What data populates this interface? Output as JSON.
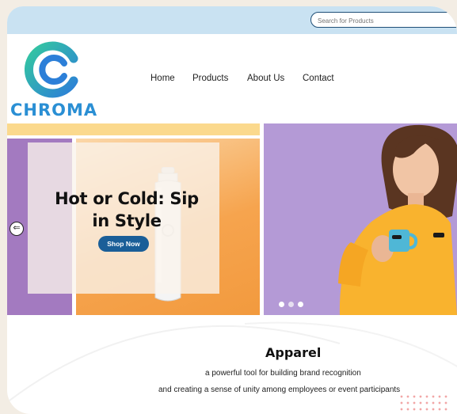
{
  "header": {
    "search_placeholder": "Search for Products"
  },
  "brand": {
    "name": "CHROMA",
    "logo_colors": [
      "#2fc3a9",
      "#2c7fd8"
    ]
  },
  "nav": {
    "items": [
      {
        "label": "Home"
      },
      {
        "label": "Products"
      },
      {
        "label": "About Us"
      },
      {
        "label": "Contact"
      }
    ]
  },
  "hero": {
    "headline_line1": "Hot or Cold: Sip",
    "headline_line2": "in Style",
    "cta_label": "Shop Now",
    "prev_arrow_glyph": "⇐",
    "carousel": {
      "slide_count": 3,
      "active_index": 0
    },
    "colors": {
      "accent": "#1a5e98",
      "orange": "#f7a046",
      "purple": "#a37ac0",
      "yellow": "#fbd98d"
    }
  },
  "section": {
    "title": "Apparel",
    "subtitle_line1": "a powerful tool for building brand recognition",
    "subtitle_line2": "and creating a sense of unity among employees or event participants"
  }
}
